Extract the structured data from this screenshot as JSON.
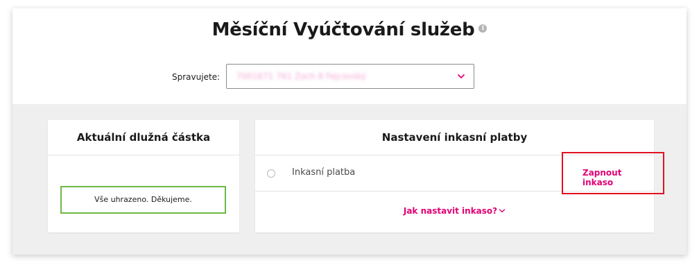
{
  "header": {
    "title": "Měsíční Vyúčtování služeb",
    "info_icon": "info-icon"
  },
  "account_select": {
    "label": "Spravujete:",
    "value": "7001671 761 Zoch 8 Fejcovský",
    "icon": "chevron-down-icon",
    "accent_color": "#e20074"
  },
  "balance_panel": {
    "title": "Aktuální dlužná částka",
    "status_text": "Vše uhrazeno. Děkujeme.",
    "status_color": "#6cb843"
  },
  "direct_debit_panel": {
    "title": "Nastavení inkasní platby",
    "option_label": "Inkasní platba",
    "enable_link": "Zapnout inkaso",
    "howto_link": "Jak nastavit inkaso?",
    "howto_icon": "chevron-down-icon",
    "highlight_color": "#e3101f"
  }
}
